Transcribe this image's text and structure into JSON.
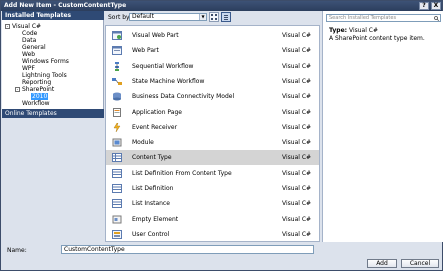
{
  "window": {
    "title": "Add New Item - CustomContentType",
    "help_label": "?",
    "close_label": "X"
  },
  "left": {
    "header": "Installed Templates",
    "tree": [
      {
        "label": "Visual C#",
        "toggle": "-"
      },
      {
        "label": "Code"
      },
      {
        "label": "Data"
      },
      {
        "label": "General"
      },
      {
        "label": "Web"
      },
      {
        "label": "Windows Forms"
      },
      {
        "label": "WPF"
      },
      {
        "label": "Lightning Tools"
      },
      {
        "label": "Reporting"
      },
      {
        "label": "SharePoint",
        "toggle": "-"
      },
      {
        "label": "2010"
      },
      {
        "label": "Workflow"
      }
    ],
    "online": "Online Templates"
  },
  "toolbar": {
    "sort_label": "Sort by:",
    "sort_value": "Default",
    "sort_arrow": "▼"
  },
  "templates": [
    {
      "name": "Visual Web Part",
      "lang": "Visual C#",
      "icon": "visual-web-part-icon"
    },
    {
      "name": "Web Part",
      "lang": "Visual C#",
      "icon": "web-part-icon"
    },
    {
      "name": "Sequential Workflow",
      "lang": "Visual C#",
      "icon": "sequential-workflow-icon"
    },
    {
      "name": "State Machine Workflow",
      "lang": "Visual C#",
      "icon": "state-machine-workflow-icon"
    },
    {
      "name": "Business Data Connectivity Model",
      "lang": "Visual C#",
      "icon": "bdc-model-icon"
    },
    {
      "name": "Application Page",
      "lang": "Visual C#",
      "icon": "application-page-icon"
    },
    {
      "name": "Event Receiver",
      "lang": "Visual C#",
      "icon": "event-receiver-icon"
    },
    {
      "name": "Module",
      "lang": "Visual C#",
      "icon": "module-icon"
    },
    {
      "name": "Content Type",
      "lang": "Visual C#",
      "icon": "content-type-icon",
      "selected": true
    },
    {
      "name": "List Definition From Content Type",
      "lang": "Visual C#",
      "icon": "list-definition-content-type-icon"
    },
    {
      "name": "List Definition",
      "lang": "Visual C#",
      "icon": "list-definition-icon"
    },
    {
      "name": "List Instance",
      "lang": "Visual C#",
      "icon": "list-instance-icon"
    },
    {
      "name": "Empty Element",
      "lang": "Visual C#",
      "icon": "empty-element-icon"
    },
    {
      "name": "User Control",
      "lang": "Visual C#",
      "icon": "user-control-icon"
    }
  ],
  "details": {
    "search_placeholder": "Search Installed Templates",
    "type_label": "Type:",
    "type_value": "Visual C#",
    "description": "A SharePoint content type item."
  },
  "bottom": {
    "name_label": "Name:",
    "name_value": "CustomContentType",
    "add_label": "Add",
    "cancel_label": "Cancel"
  },
  "colors": {
    "header_blue": "#2F4A75",
    "selection_gray": "#D4D4D4",
    "dialog_bg": "#DCE2EC"
  }
}
